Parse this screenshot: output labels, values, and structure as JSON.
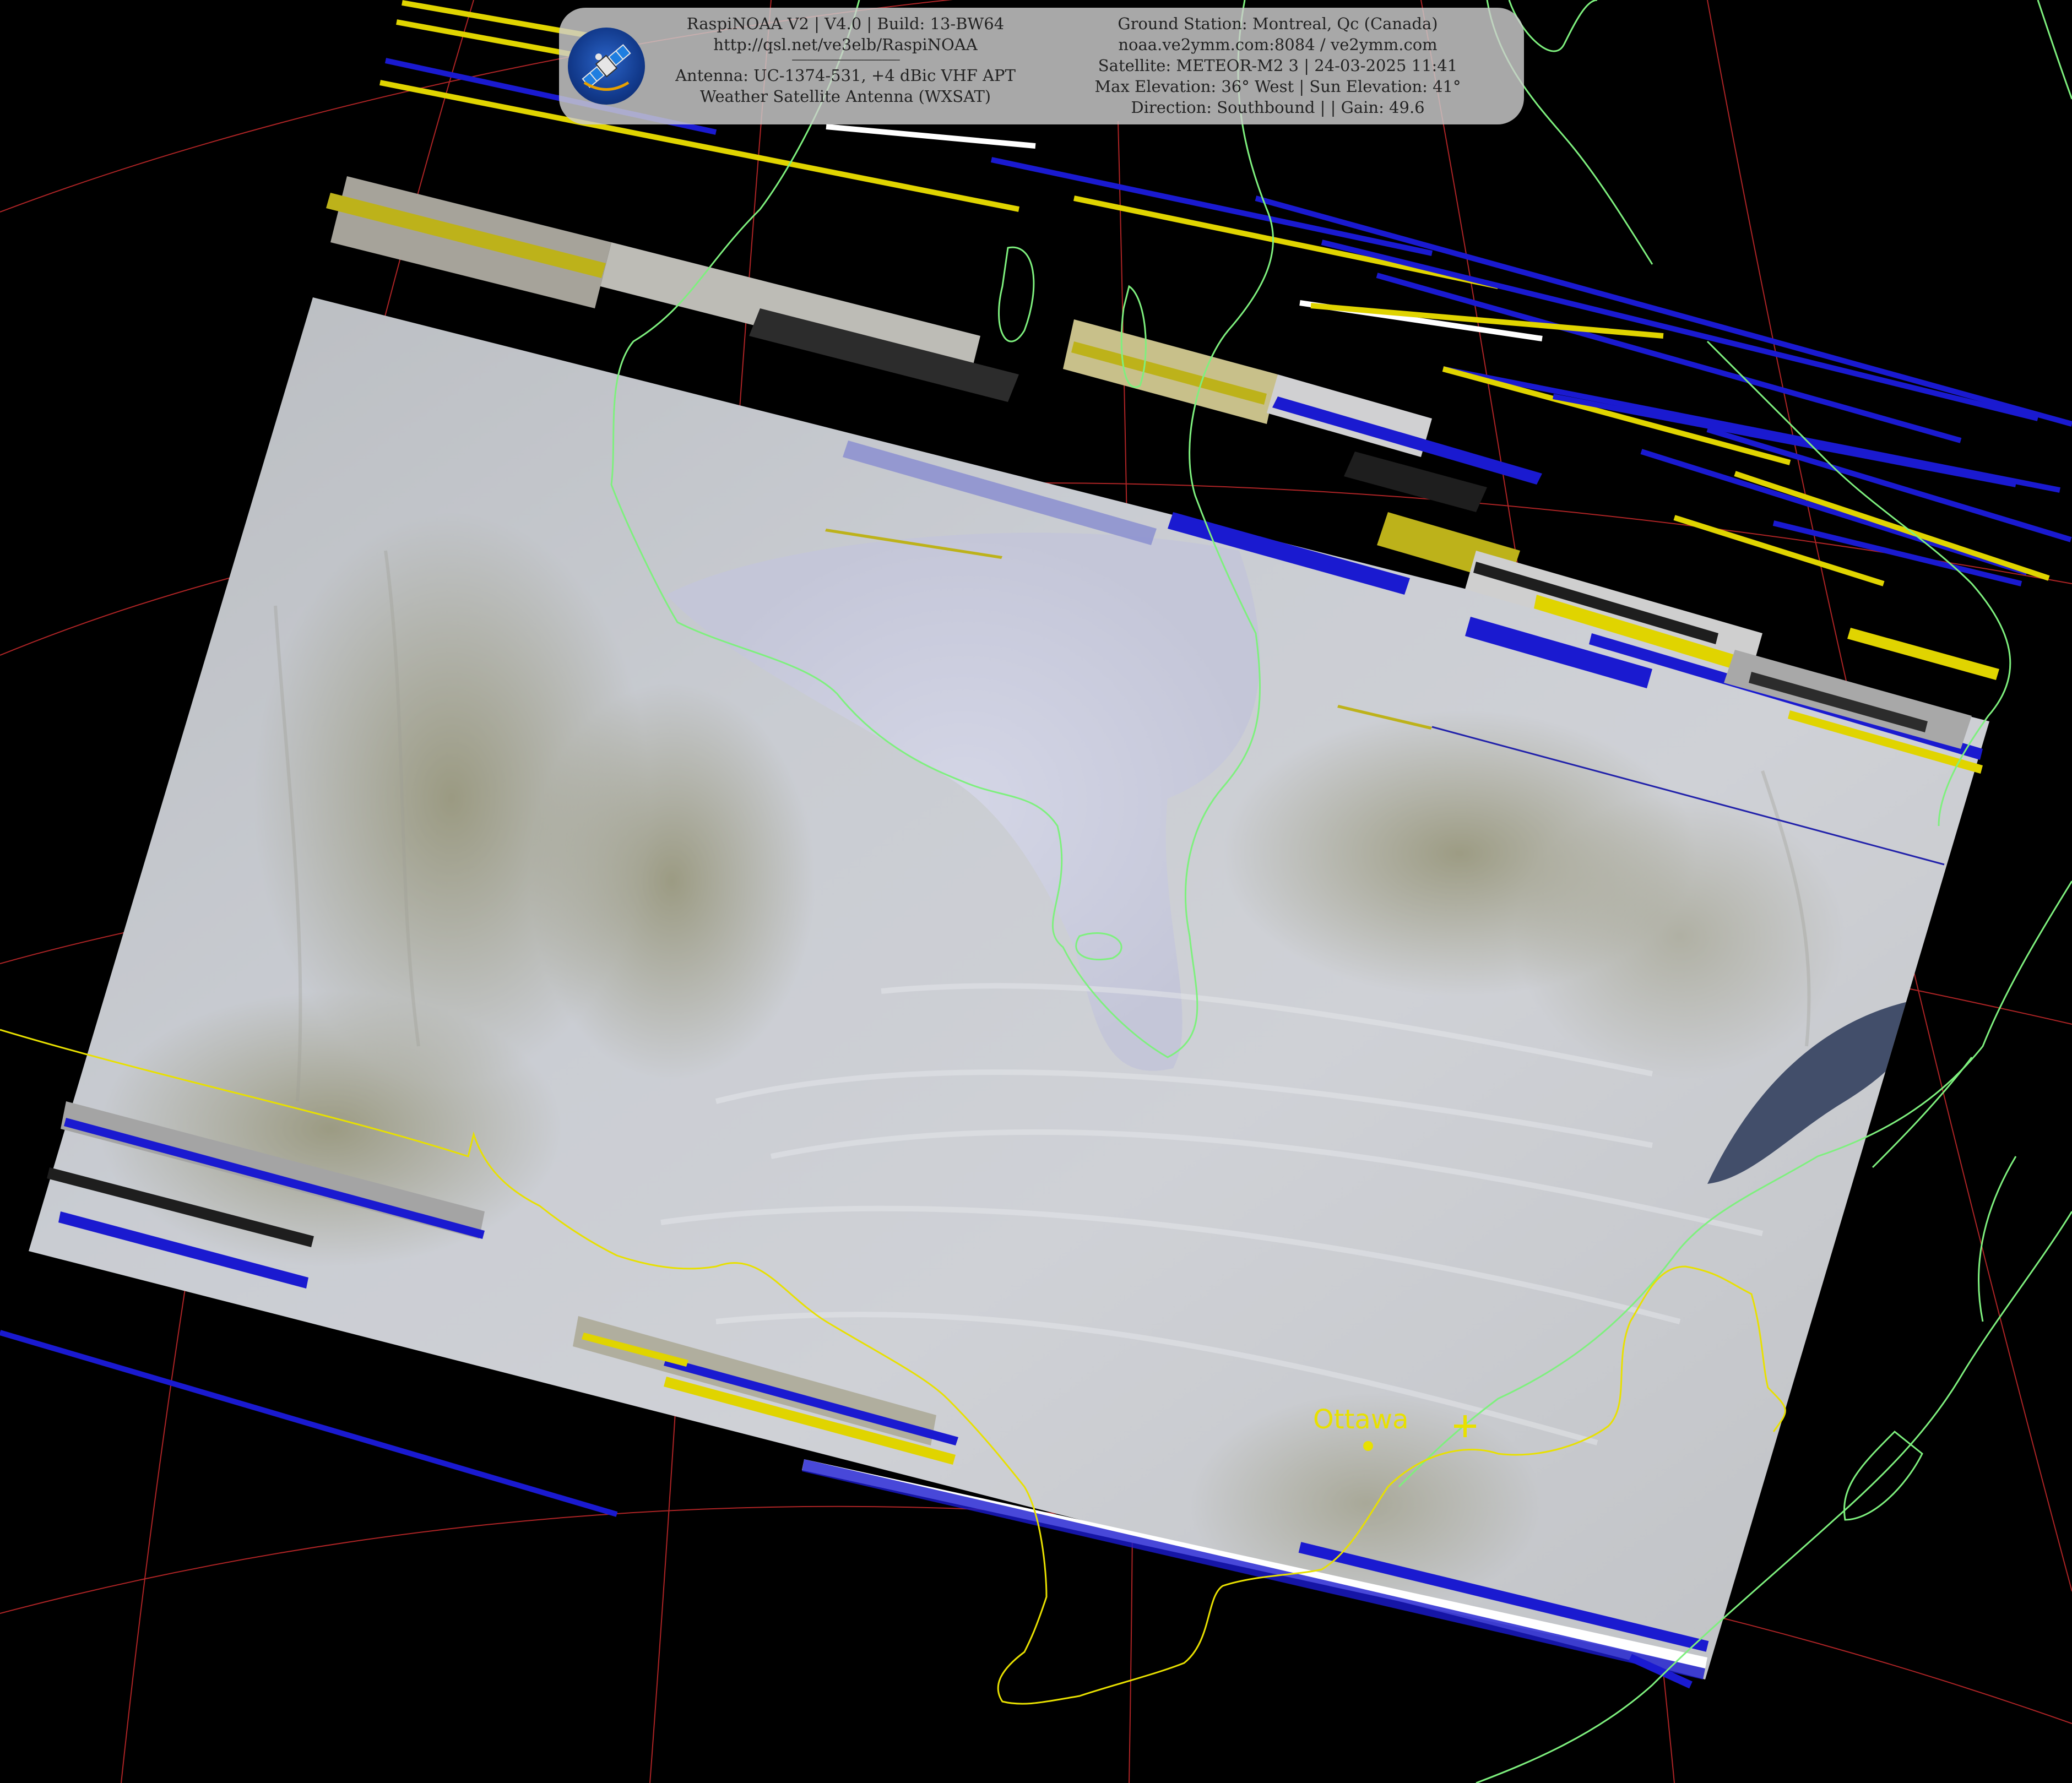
{
  "header": {
    "left_lines": [
      "RaspiNOAA V2 | V4.0 | Build: 13-BW64",
      "http://qsl.net/ve3elb/RaspiNOAA",
      "Antenna: UC-1374-531, +4 dBic VHF APT",
      "Weather Satellite Antenna (WXSAT)"
    ],
    "separator": "------------------------------------",
    "right_lines": [
      "Ground Station: Montreal, Qc (Canada)",
      "noaa.ve2ymm.com:8084 / ve2ymm.com",
      "Satellite: METEOR-M2 3 | 24-03-2025 11:41",
      "Max Elevation: 36° West | Sun Elevation: 41°",
      "Direction: Southbound | | Gain: 49.6"
    ],
    "logo_icon": "satellite-icon"
  },
  "map": {
    "city_label": "Ottawa",
    "ground_station_marker_icon": "plus-icon",
    "colors": {
      "background": "#000000",
      "coastline": "#7ef07e",
      "border": "#e8e000",
      "graticule": "#c0282a",
      "noise_yellow": "#e0d400",
      "noise_blue": "#1a1ad0",
      "noise_white": "#ffffff"
    }
  }
}
